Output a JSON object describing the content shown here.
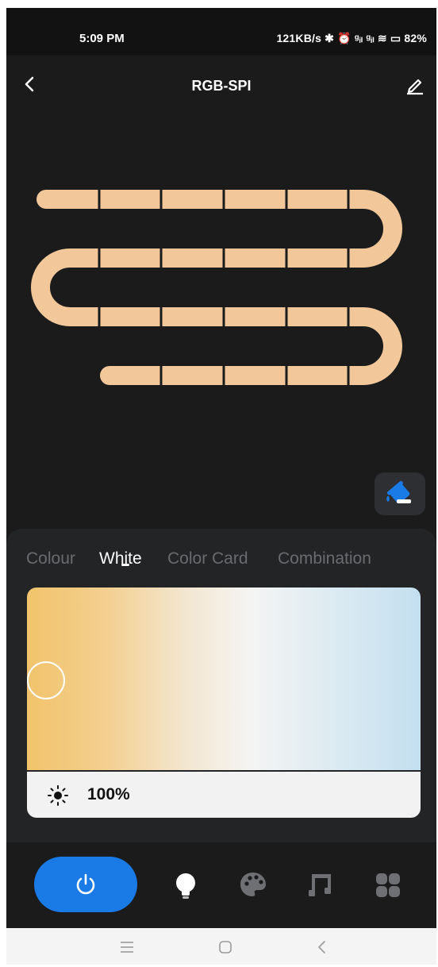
{
  "status_bar": {
    "time": "5:09 PM",
    "indicators": "121KB/s ✱ ⏰ ᵍᵢₗ ᵍᵢₗ ≋ ▭ 82%"
  },
  "header": {
    "title": "RGB-SPI",
    "back_icon": "chevron-left-icon",
    "edit_icon": "pencil-icon"
  },
  "strip_color": "#f2c89b",
  "tabs": {
    "items": [
      "Colour",
      "White",
      "Color Card",
      "Combination"
    ],
    "active": "White"
  },
  "white_picker": {
    "warm_color": "#f1c36b",
    "cool_color": "#c3dff0"
  },
  "brightness": {
    "value": "100%",
    "icon": "sun-icon"
  },
  "bottom_nav": {
    "power_color": "#1a7ae6",
    "items": [
      "power-icon",
      "bulb-icon",
      "palette-icon",
      "music-icon",
      "grid-icon"
    ]
  },
  "system_nav": [
    "menu-icon",
    "home-icon",
    "back-icon"
  ]
}
